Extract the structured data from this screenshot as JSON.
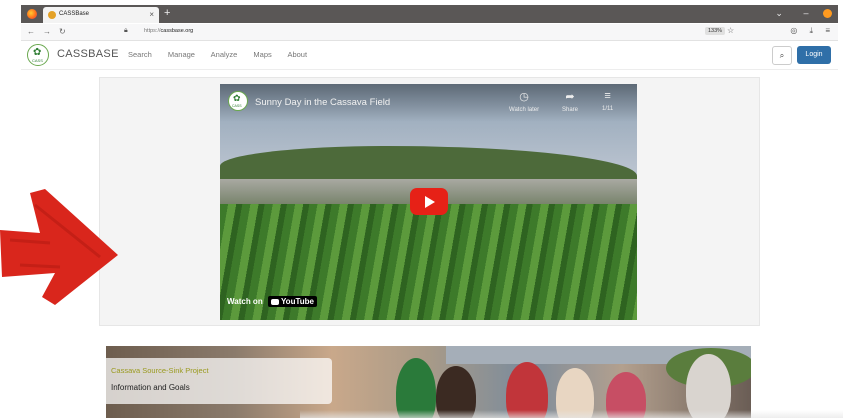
{
  "browser": {
    "tab_title": "CASSBase",
    "tab_close": "×",
    "new_tab": "+",
    "url_prefix": "https://",
    "url_host": "cassbase.org",
    "zoom": "133%"
  },
  "site": {
    "logo_text": "CASS",
    "name": "CASSBASE",
    "nav": [
      "Search",
      "Manage",
      "Analyze",
      "Maps",
      "About"
    ],
    "login": "Login"
  },
  "video": {
    "channel_logo_text": "CASS",
    "title": "Sunny Day in the Cassava Field",
    "actions": [
      "Watch later",
      "Share",
      "1/11"
    ],
    "watch_on": "Watch on",
    "youtube": "YouTube"
  },
  "banner": {
    "project_title": "Cassava Source-Sink Project",
    "subtitle": "Information and Goals"
  },
  "colors": {
    "accent": "#2f6fa8",
    "youtube_red": "#e62117",
    "arrow_red": "#d9261c",
    "project_title": "#9a9a1f"
  }
}
